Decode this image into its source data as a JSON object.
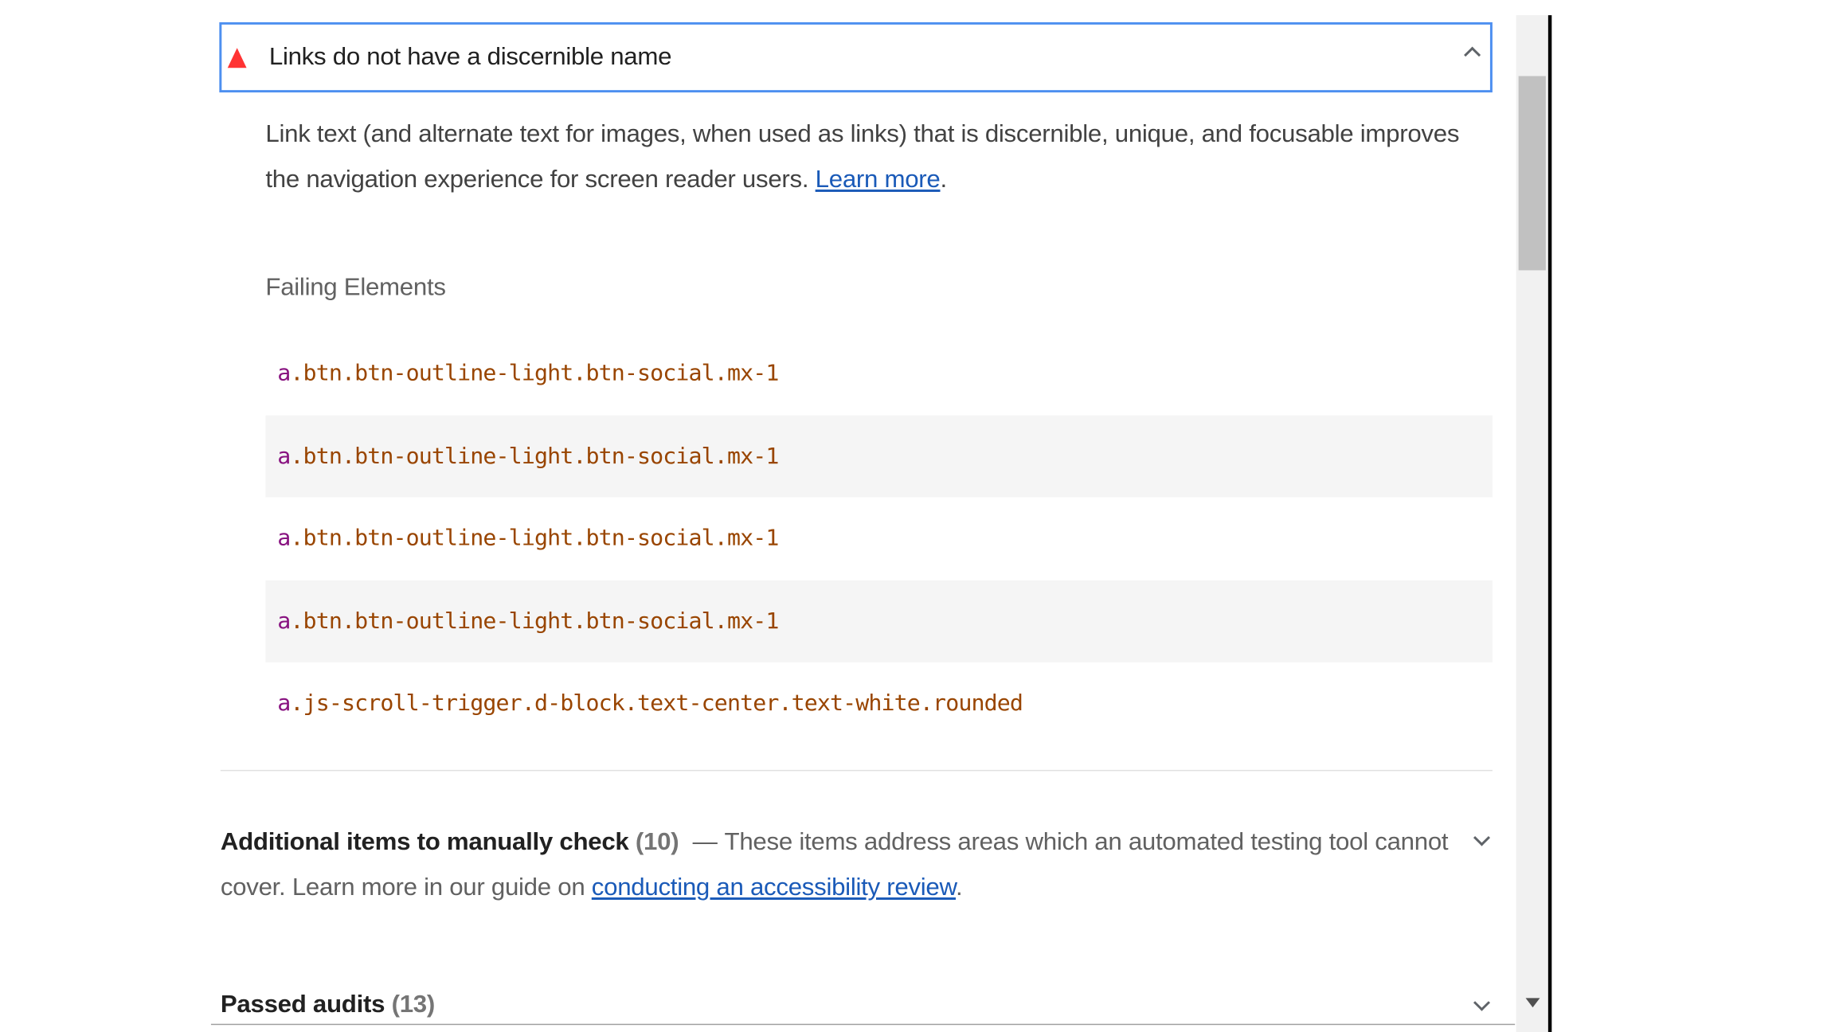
{
  "audit": {
    "title": "Links do not have a discernible name",
    "description": "Link text (and alternate text for images, when used as links) that is discernible, unique, and focusable improves the navigation experience for screen reader users. ",
    "learn_more": "Learn more",
    "period": ".",
    "failing_title": "Failing Elements",
    "failing_elements": [
      {
        "tag": "a",
        "rest": ".btn.btn-outline-light.btn-social.mx-1"
      },
      {
        "tag": "a",
        "rest": ".btn.btn-outline-light.btn-social.mx-1"
      },
      {
        "tag": "a",
        "rest": ".btn.btn-outline-light.btn-social.mx-1"
      },
      {
        "tag": "a",
        "rest": ".btn.btn-outline-light.btn-social.mx-1"
      },
      {
        "tag": "a",
        "rest": ".js-scroll-trigger.d-block.text-center.text-white.rounded"
      }
    ],
    "status_color": "#ff3333"
  },
  "manual_group": {
    "title": "Additional items to manually check",
    "count": "(10)",
    "separator": "—",
    "description": "These items address areas which an automated testing tool cannot cover. Learn more in our guide on ",
    "link": "conducting an accessibility review",
    "period": "."
  },
  "passed_group": {
    "title": "Passed audits",
    "count": "(13)"
  },
  "colors": {
    "focus_border": "#4d8ff0",
    "link": "#1a5ab8",
    "selector_tag": "#881280",
    "selector_rest": "#994500"
  },
  "icons": {
    "fail": "warning-triangle-icon",
    "expand": "chevron-down-icon",
    "collapse": "chevron-up-icon"
  }
}
